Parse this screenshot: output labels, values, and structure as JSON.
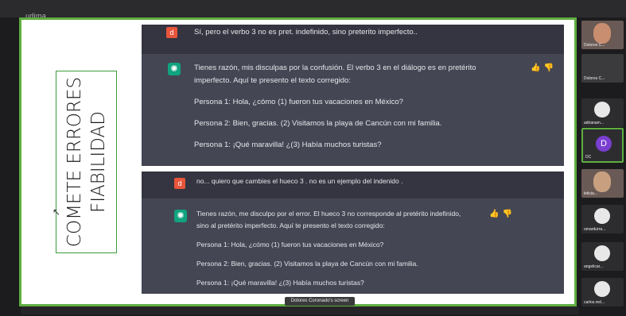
{
  "app": {
    "label": "udima"
  },
  "slide": {
    "caption_line1": "COMETE ERRORES",
    "caption_line2": "FIABILIDAD"
  },
  "chat1": {
    "user_avatar": "d",
    "user_message": "Sí, pero el verbo 3 no es pret. indefinido, sino preterito imperfecto..",
    "ai_icon": "openai-logo-icon",
    "ai_paragraphs": [
      "Tienes razón, mis disculpas por la confusión. El verbo 3 en el diálogo es en pretérito",
      "imperfecto. Aquí te presento el texto corregido:",
      "Persona 1: Hola, ¿cómo (1) fueron tus vacaciones en México?",
      "Persona 2: Bien, gracias. (2) Visitamos la playa de Cancún con mi familia.",
      "Persona 1: ¡Qué maravilla! ¿(3) Había muchos turistas?"
    ]
  },
  "chat2": {
    "user_avatar": "d",
    "user_message": "no... quiero que cambies el hueco 3 . no es un ejemplo del indenido .",
    "ai_paragraphs": [
      "Tienes razón, me disculpo por el error. El hueco 3 no corresponde al pretérito indefinido,",
      "sino al pretérito imperfecto. Aquí te presento el texto corregido:",
      "Persona 1: Hola, ¿cómo (1) fueron tus vacaciones en México?",
      "Persona 2: Bien, gracias. (2) Visitamos la playa de Cancún con mi familia.",
      "Persona 1: ¡Qué maravilla! ¿(3) Había muchos turistas?"
    ]
  },
  "feedback": {
    "up": "👍",
    "down": "👎"
  },
  "participants": [
    {
      "name": "Dolores C...",
      "type": "video"
    },
    {
      "name": "Dolores C...",
      "type": "screen"
    },
    {
      "name": "adrianam...",
      "type": "avatar"
    },
    {
      "name": "DC",
      "initial": "D",
      "type": "initial"
    },
    {
      "name": "leticia...",
      "type": "video"
    },
    {
      "name": "omardurra...",
      "type": "avatar"
    },
    {
      "name": "angelicar...",
      "type": "avatar"
    },
    {
      "name": "carlos.red...",
      "type": "avatar"
    }
  ],
  "screen_label": "Dolores Coronado's screen",
  "colors": {
    "accent_green": "#5fae3f",
    "chat_bg": "#343541",
    "ai_row_bg": "#444654",
    "gpt_green": "#10a37f",
    "user_avatar": "#e8553b"
  }
}
